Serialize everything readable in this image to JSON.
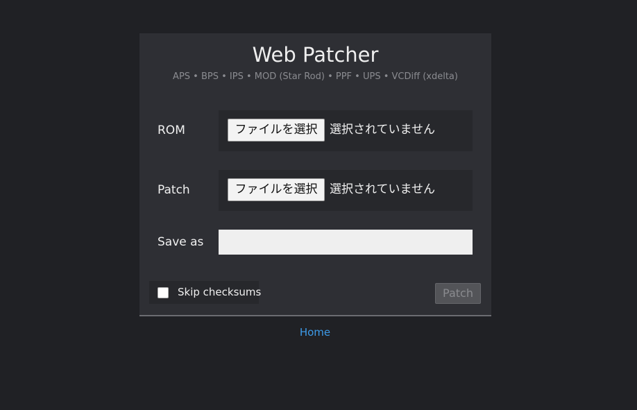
{
  "header": {
    "title": "Web Patcher",
    "formats": "APS • BPS • IPS • MOD (Star Rod) • PPF • UPS • VCDiff (xdelta)"
  },
  "form": {
    "rom": {
      "label": "ROM",
      "button_label": "ファイルを選択",
      "status": "選択されていません"
    },
    "patch": {
      "label": "Patch",
      "button_label": "ファイルを選択",
      "status": "選択されていません"
    },
    "save_as": {
      "label": "Save as",
      "value": ""
    },
    "skip_checksums": {
      "label": "Skip checksums",
      "checked": false
    },
    "submit_label": "Patch"
  },
  "footer": {
    "home_link": "Home"
  },
  "colors": {
    "background": "#202125",
    "panel": "#2e2f34",
    "link": "#3d9be9"
  }
}
